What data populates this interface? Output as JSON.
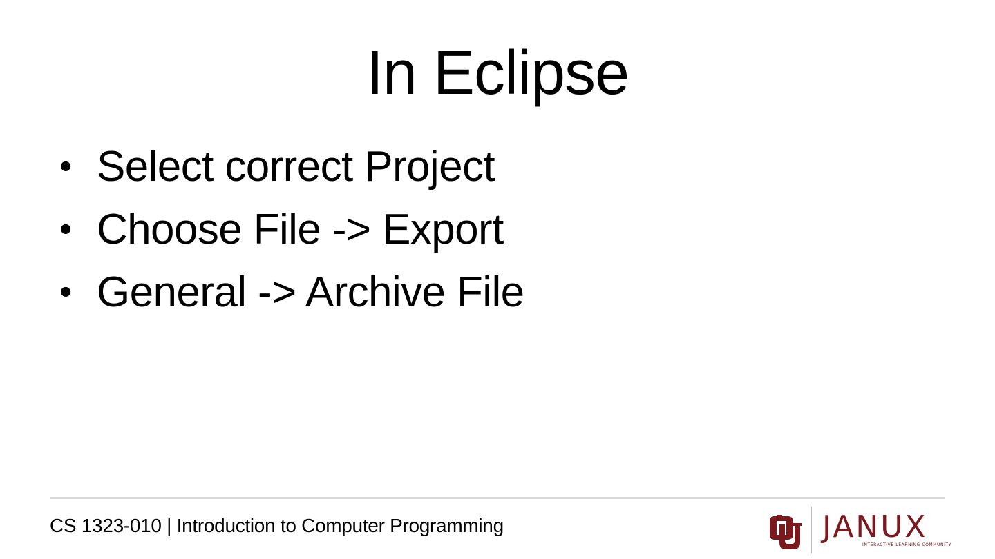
{
  "slide": {
    "title": "In Eclipse",
    "bullets": [
      "Select correct Project",
      "Choose File -> Export",
      "General -> Archive File"
    ],
    "bullet_glyph": "•"
  },
  "footer": {
    "course_text": "CS 1323-010 | Introduction to Computer Programming",
    "logo": {
      "ou_icon": "ou-interlocking-logo-icon",
      "wordmark": "JANUX",
      "tagline": "INTERACTIVE LEARNING COMMUNITY",
      "brand_color": "#7a1a1f"
    },
    "divider_color": "#d9d9d9"
  }
}
